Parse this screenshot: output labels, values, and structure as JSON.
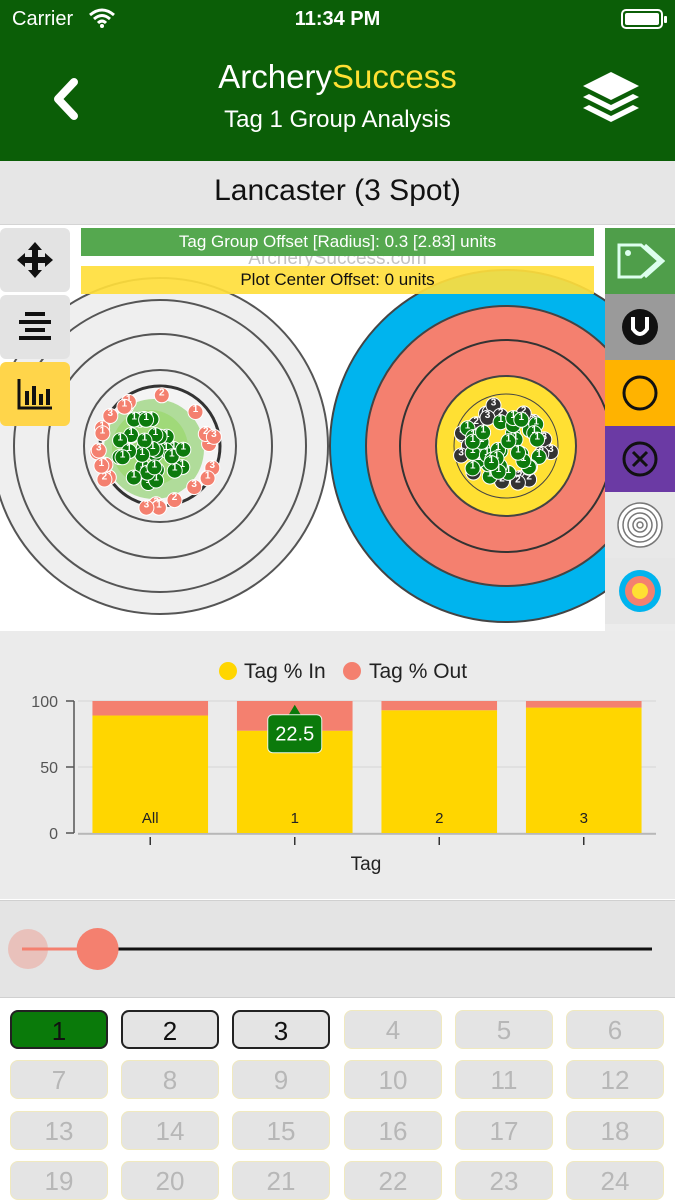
{
  "status": {
    "carrier": "Carrier",
    "time": "11:34 PM"
  },
  "nav": {
    "title_prefix": "Archery",
    "title_accent": "Success",
    "subtitle": "Tag 1 Group Analysis"
  },
  "heading": "Lancaster (3 Spot)",
  "target": {
    "group_offset": "Tag Group Offset [Radius]: 0.3 [2.83] units",
    "watermark": "ArcherySuccess.com",
    "center_offset": "Plot Center Offset: 0 units",
    "arrow_label_in": "1",
    "colors": {
      "blue": "#00b4ee",
      "red": "#f4806f",
      "gold": "#ffe033",
      "green": "#0d7a0d"
    }
  },
  "left_tools": [
    {
      "name": "move-icon",
      "active": false
    },
    {
      "name": "align-icon",
      "active": false
    },
    {
      "name": "bar-chart-icon",
      "active": true
    }
  ],
  "right_tools": [
    {
      "name": "tag-icon",
      "bg": "#4f9e4a"
    },
    {
      "name": "u-circle-icon",
      "bg": "#9a9a9a"
    },
    {
      "name": "circle-icon",
      "bg": "#ffb300"
    },
    {
      "name": "x-circle-icon",
      "bg": "#6b3aa4"
    },
    {
      "name": "white-target-icon",
      "bg": "#e8e8e8"
    },
    {
      "name": "color-target-icon",
      "bg": "#e6e6e6"
    },
    {
      "name": "three-spot-icon",
      "bg": "#ececec"
    },
    {
      "name": "vertical-spot-icon",
      "bg": "#ececec"
    },
    {
      "name": "small-rings-icon",
      "bg": "#ececec"
    }
  ],
  "chart_data": {
    "type": "bar",
    "stacked": true,
    "categories": [
      "All",
      "1",
      "2",
      "3"
    ],
    "series": [
      {
        "name": "Tag % In",
        "values": [
          89,
          77.5,
          93,
          95
        ],
        "color": "#ffd600"
      },
      {
        "name": "Tag % Out",
        "values": [
          11,
          22.5,
          7,
          5
        ],
        "color": "#f4806f"
      }
    ],
    "xlabel": "Tag",
    "ylabel": "",
    "ylim": [
      0,
      100
    ],
    "yticks": [
      0,
      50,
      100
    ],
    "legend": "top-center",
    "grid": true,
    "highlight": {
      "category": "1",
      "label": "22.5"
    }
  },
  "slider": {
    "value": 0.12
  },
  "tags": [
    "1",
    "2",
    "3",
    "4",
    "5",
    "6",
    "7",
    "8",
    "9",
    "10",
    "11",
    "12",
    "13",
    "14",
    "15",
    "16",
    "17",
    "18",
    "19",
    "20",
    "21",
    "22",
    "23",
    "24"
  ],
  "tag_states": {
    "selected": [
      "1"
    ],
    "enabled": [
      "2",
      "3"
    ]
  }
}
